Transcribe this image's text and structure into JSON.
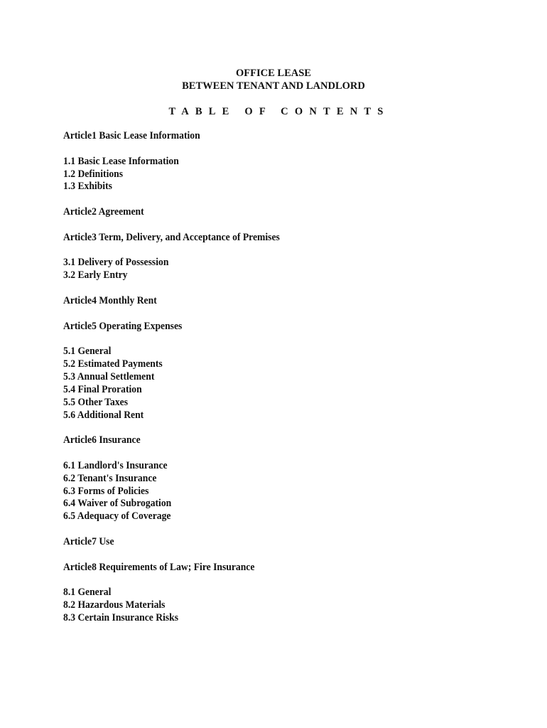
{
  "document": {
    "title_line1": "OFFICE LEASE",
    "title_line2": "BETWEEN TENANT AND LANDLORD",
    "toc_heading": "TABLE OF CONTENTS",
    "sections": [
      {
        "article": "Article1 Basic Lease Information",
        "items": [
          "1.1 Basic Lease Information",
          "1.2 Definitions",
          "1.3 Exhibits"
        ]
      },
      {
        "article": "Article2 Agreement",
        "items": []
      },
      {
        "article": "Article3 Term, Delivery, and Acceptance of Premises",
        "items": [
          "3.1 Delivery of Possession",
          "3.2 Early Entry"
        ]
      },
      {
        "article": "Article4 Monthly Rent",
        "items": []
      },
      {
        "article": "Article5 Operating Expenses",
        "items": [
          "5.1 General",
          "5.2 Estimated Payments",
          "5.3 Annual Settlement",
          "5.4 Final Proration",
          "5.5 Other Taxes",
          "5.6 Additional Rent"
        ]
      },
      {
        "article": "Article6 Insurance",
        "items": [
          "6.1 Landlord's Insurance",
          "6.2 Tenant's Insurance",
          "6.3 Forms of Policies",
          "6.4 Waiver of Subrogation",
          "6.5 Adequacy of Coverage"
        ]
      },
      {
        "article": "Article7 Use",
        "items": []
      },
      {
        "article": "Article8 Requirements of Law; Fire Insurance",
        "items": [
          "8.1 General",
          "8.2 Hazardous Materials",
          "8.3 Certain Insurance Risks"
        ]
      }
    ]
  }
}
